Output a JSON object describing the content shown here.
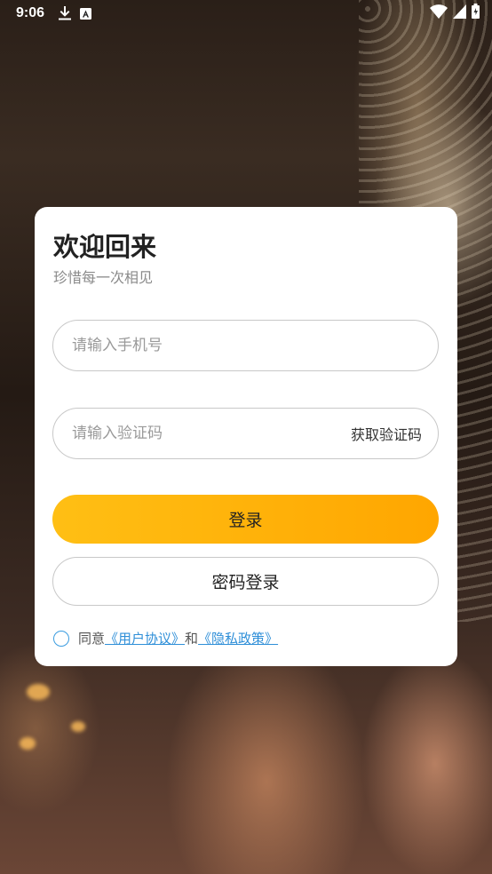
{
  "status_bar": {
    "time": "9:06",
    "icons": [
      "download-icon",
      "a-notification-icon",
      "wifi-icon",
      "signal-icon",
      "battery-icon"
    ]
  },
  "card": {
    "title": "欢迎回来",
    "subtitle": "珍惜每一次相见",
    "phone_placeholder": "请输入手机号",
    "code_placeholder": "请输入验证码",
    "get_code_label": "获取验证码",
    "login_label": "登录",
    "password_login_label": "密码登录",
    "agree": {
      "prefix": "同意",
      "user_agreement": "《用户协议》",
      "and": "和",
      "privacy_policy": "《隐私政策》"
    }
  },
  "colors": {
    "accent_start": "#ffbf14",
    "accent_end": "#ffa600",
    "link": "#2f8fd8"
  }
}
